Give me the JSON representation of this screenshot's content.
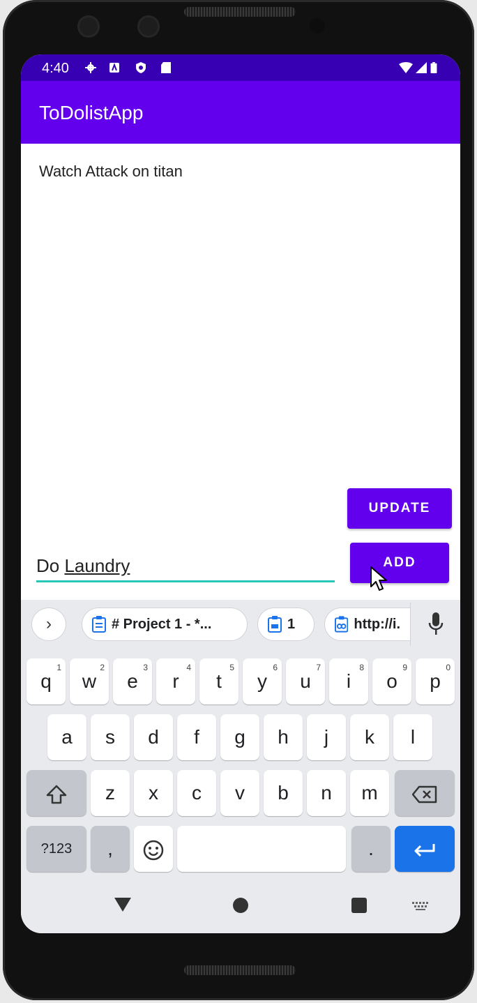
{
  "status_bar": {
    "time": "4:40",
    "icons": [
      "gear-icon",
      "notification-icon",
      "shield-icon",
      "sd-card-icon",
      "wifi-icon",
      "signal-icon",
      "battery-icon"
    ]
  },
  "app": {
    "title": "ToDolistApp"
  },
  "todos": [
    "Watch Attack on titan"
  ],
  "buttons": {
    "update": "UPDATE",
    "add": "ADD"
  },
  "input": {
    "value_prefix": "Do ",
    "value_word": "Laundry"
  },
  "keyboard": {
    "suggestions": [
      "# Project 1 - *...",
      "1",
      "http://i."
    ],
    "row1": [
      {
        "k": "q",
        "n": "1"
      },
      {
        "k": "w",
        "n": "2"
      },
      {
        "k": "e",
        "n": "3"
      },
      {
        "k": "r",
        "n": "4"
      },
      {
        "k": "t",
        "n": "5"
      },
      {
        "k": "y",
        "n": "6"
      },
      {
        "k": "u",
        "n": "7"
      },
      {
        "k": "i",
        "n": "8"
      },
      {
        "k": "o",
        "n": "9"
      },
      {
        "k": "p",
        "n": "0"
      }
    ],
    "row2": [
      "a",
      "s",
      "d",
      "f",
      "g",
      "h",
      "j",
      "k",
      "l"
    ],
    "row3": [
      "z",
      "x",
      "c",
      "v",
      "b",
      "n",
      "m"
    ],
    "symbols_label": "?123",
    "comma": ",",
    "period": "."
  },
  "colors": {
    "primary": "#6200ee",
    "primary_dark": "#3700b3",
    "accent": "#26c6b8",
    "enter": "#1a73e8"
  }
}
